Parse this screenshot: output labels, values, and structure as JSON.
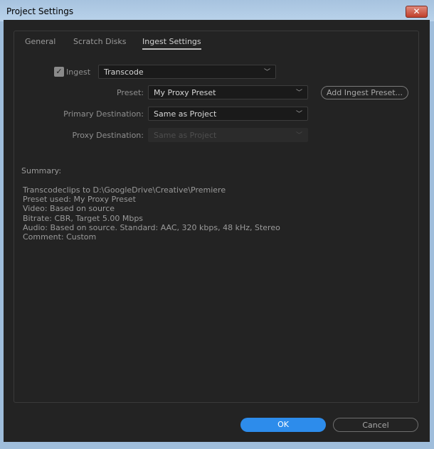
{
  "window": {
    "title": "Project Settings",
    "close_label": "✕"
  },
  "tabs": [
    {
      "label": "General"
    },
    {
      "label": "Scratch Disks"
    },
    {
      "label": "Ingest Settings"
    }
  ],
  "ingest": {
    "checkbox_label": "Ingest",
    "checked": true,
    "mode": "Transcode"
  },
  "preset": {
    "label": "Preset:",
    "value": "My Proxy Preset",
    "add_button": "Add Ingest Preset..."
  },
  "primary_destination": {
    "label": "Primary Destination:",
    "value": "Same as Project"
  },
  "proxy_destination": {
    "label": "Proxy Destination:",
    "value": "Same as Project"
  },
  "summary": {
    "heading": "Summary:",
    "lines": [
      "Transcodeclips to D:\\GoogleDrive\\Creative\\Premiere",
      "Preset used: My Proxy Preset",
      "Video: Based on source",
      "Bitrate: CBR, Target 5.00 Mbps",
      "Audio: Based on source. Standard: AAC, 320 kbps, 48 kHz, Stereo",
      "Comment: Custom"
    ]
  },
  "buttons": {
    "ok": "OK",
    "cancel": "Cancel"
  }
}
